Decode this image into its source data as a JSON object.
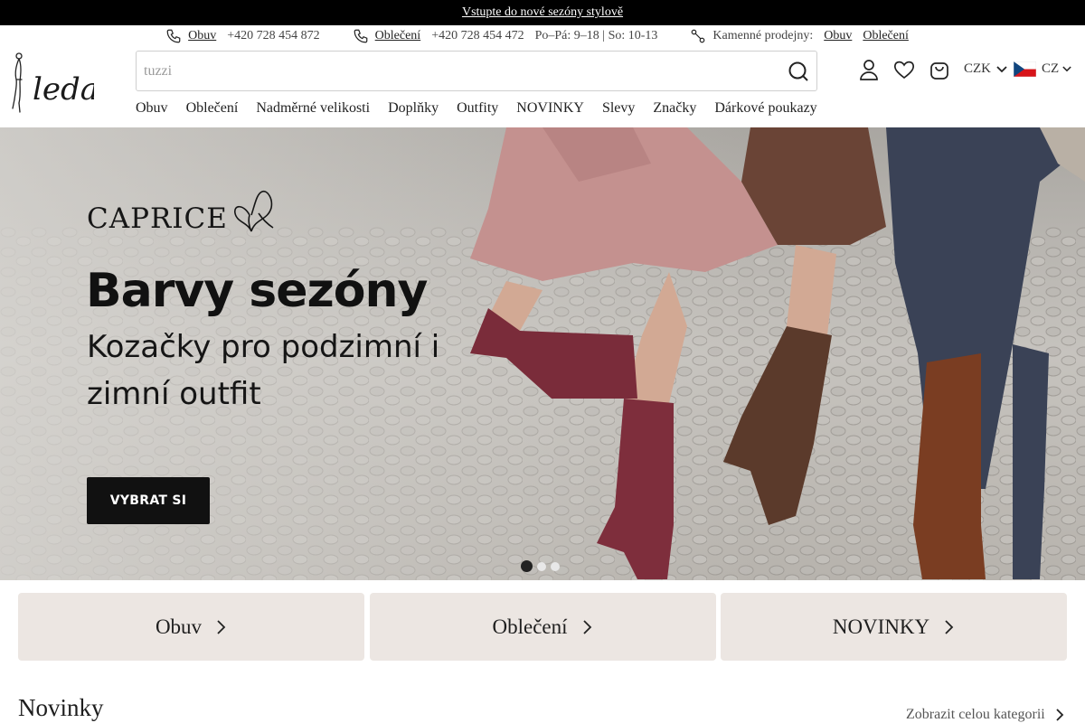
{
  "announcement": {
    "text": "Vstupte do nové sezóny stylově"
  },
  "contact": {
    "shoes_label": "Obuv",
    "shoes_phone": "+420 728 454 872",
    "clothes_label": "Oblečení",
    "clothes_phone": "+420 728 454 472",
    "hours": "Po–Pá: 9–18 | So: 10-13",
    "stores_label": "Kamenné prodejny:",
    "stores_shoes": "Obuv",
    "stores_clothes": "Oblečení"
  },
  "header": {
    "logo_text": "leda",
    "search_placeholder": "tuzzi",
    "currency": "CZK",
    "language": "CZ",
    "icons": [
      "user-icon",
      "heart-icon",
      "bag-icon"
    ]
  },
  "nav": [
    "Obuv",
    "Oblečení",
    "Nadměrné velikosti",
    "Doplňky",
    "Outfity",
    "NOVINKY",
    "Slevy",
    "Značky",
    "Dárkové poukazy"
  ],
  "hero": {
    "brand": "CAPRICE",
    "title": "Barvy sezóny",
    "subtitle": "Kozačky pro podzimní i zimní outfit",
    "cta": "VYBRAT SI",
    "slides": 3,
    "active_slide": 1
  },
  "tiles": [
    "Obuv",
    "Oblečení",
    "NOVINKY"
  ],
  "section": {
    "title": "Novinky",
    "link": "Zobrazit celou kategorii"
  },
  "colors": {
    "accent_dark": "#000000",
    "tile_bg": "#ece6e2",
    "flag_blue": "#11457e",
    "flag_red": "#d7141a"
  }
}
